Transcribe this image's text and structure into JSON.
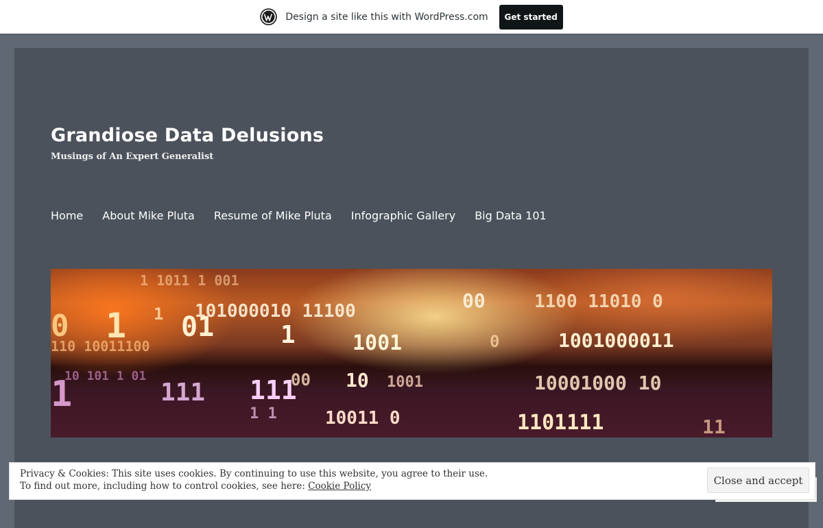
{
  "banner": {
    "logo_icon": "wordpress-logo-icon",
    "text": "Design a site like this with WordPress.com",
    "button_label": "Get started"
  },
  "site": {
    "title": "Grandiose Data Delusions",
    "description": "Musings of An Expert Generalist"
  },
  "nav": {
    "items": [
      {
        "label": "Home"
      },
      {
        "label": "About Mike Pluta"
      },
      {
        "label": "Resume of Mike Pluta"
      },
      {
        "label": "Infographic Gallery"
      },
      {
        "label": "Big Data 101"
      }
    ]
  },
  "cookie": {
    "line1": "Privacy & Cookies: This site uses cookies. By continuing to use this website, you agree to their use.",
    "line2_prefix": "To find out more, including how to control cookies, see here: ",
    "link_label": "Cookie Policy",
    "button_label": "Close and accept"
  },
  "colors": {
    "page_bg": "#5f6873",
    "site_bg": "#4b525b",
    "banner_button": "#101517"
  }
}
